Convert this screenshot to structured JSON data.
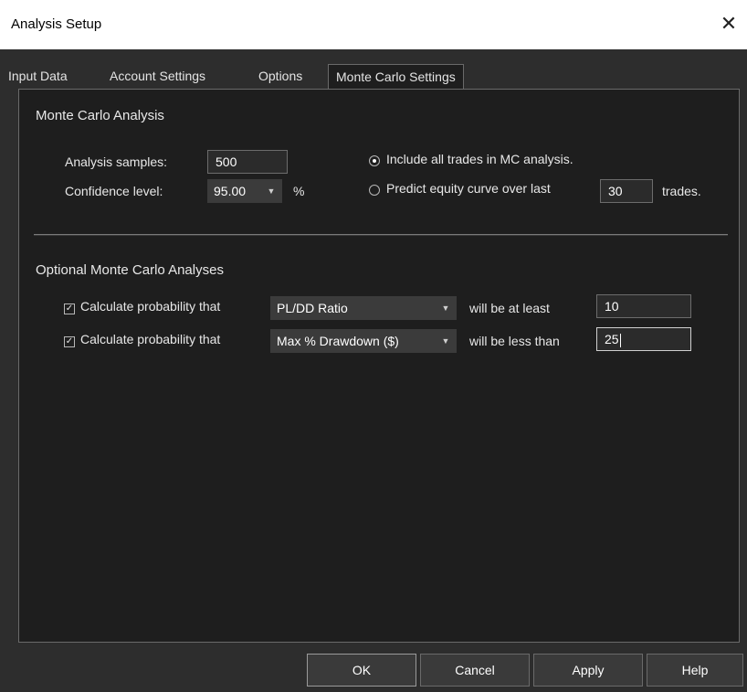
{
  "window": {
    "title": "Analysis Setup",
    "close_glyph": "✕"
  },
  "tabs": [
    {
      "label": "Input Data"
    },
    {
      "label": "Account Settings"
    },
    {
      "label": "Options"
    },
    {
      "label": "Monte Carlo Settings"
    }
  ],
  "monte_carlo": {
    "title": "Monte Carlo Analysis",
    "samples_label": "Analysis samples:",
    "samples_value": "500",
    "confidence_label": "Confidence level:",
    "confidence_value": "95.00",
    "confidence_unit": "%",
    "include_all_label": "Include all trades in MC analysis.",
    "predict_label": "Predict equity curve over last",
    "predict_value": "30",
    "predict_suffix": "trades."
  },
  "optional": {
    "title": "Optional Monte Carlo Analyses",
    "rows": [
      {
        "label": "Calculate probability that",
        "metric": "PL/DD Ratio",
        "comparison": "will be at least",
        "value": "10"
      },
      {
        "label": "Calculate probability that",
        "metric": "Max % Drawdown ($)",
        "comparison": "will be less than",
        "value": "25"
      }
    ]
  },
  "buttons": {
    "ok": "OK",
    "cancel": "Cancel",
    "apply": "Apply",
    "help": "Help"
  },
  "icons": {
    "check": "✓",
    "dropdown": "▼"
  }
}
